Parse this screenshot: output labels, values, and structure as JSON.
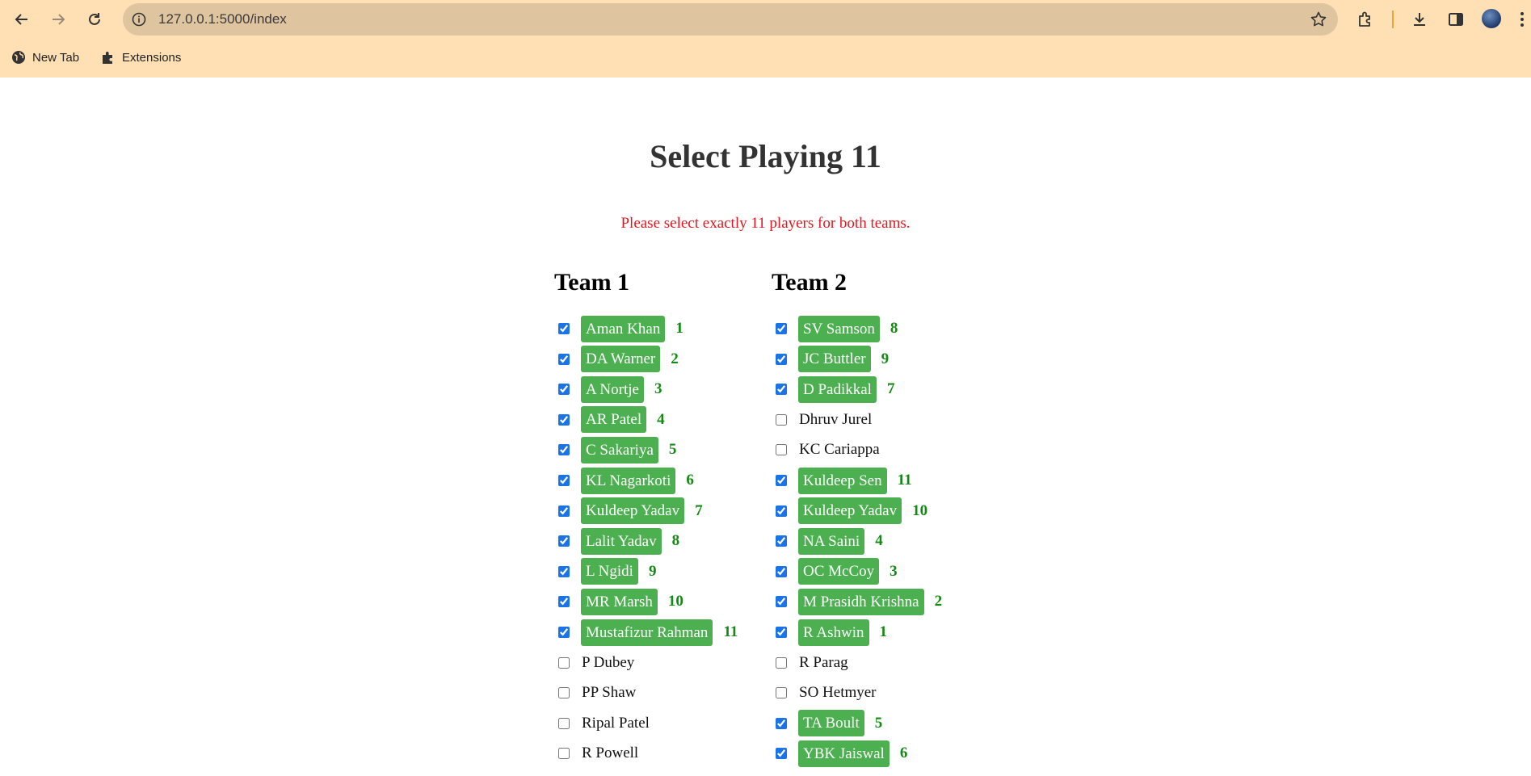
{
  "browser": {
    "url": "127.0.0.1:5000/index",
    "bookmarks": [
      {
        "label": "New Tab",
        "icon": "globe-icon"
      },
      {
        "label": "Extensions",
        "icon": "puzzle-icon"
      }
    ],
    "chrome_color": "#ffe0b5"
  },
  "page": {
    "title": "Select Playing 11",
    "error": "Please select exactly 11 players for both teams.",
    "accent_color": "#4caf50",
    "error_color": "#e8141d"
  },
  "teams": [
    {
      "name": "Team 1",
      "players": [
        {
          "name": "Aman Khan",
          "checked": true,
          "order": "1"
        },
        {
          "name": "DA Warner",
          "checked": true,
          "order": "2"
        },
        {
          "name": "A Nortje",
          "checked": true,
          "order": "3"
        },
        {
          "name": "AR Patel",
          "checked": true,
          "order": "4"
        },
        {
          "name": "C Sakariya",
          "checked": true,
          "order": "5"
        },
        {
          "name": "KL Nagarkoti",
          "checked": true,
          "order": "6"
        },
        {
          "name": "Kuldeep Yadav",
          "checked": true,
          "order": "7"
        },
        {
          "name": "Lalit Yadav",
          "checked": true,
          "order": "8"
        },
        {
          "name": "L Ngidi",
          "checked": true,
          "order": "9"
        },
        {
          "name": "MR Marsh",
          "checked": true,
          "order": "10"
        },
        {
          "name": "Mustafizur Rahman",
          "checked": true,
          "order": "11"
        },
        {
          "name": "P Dubey",
          "checked": false,
          "order": ""
        },
        {
          "name": "PP Shaw",
          "checked": false,
          "order": ""
        },
        {
          "name": "Ripal Patel",
          "checked": false,
          "order": ""
        },
        {
          "name": "R Powell",
          "checked": false,
          "order": ""
        }
      ]
    },
    {
      "name": "Team 2",
      "players": [
        {
          "name": "SV Samson",
          "checked": true,
          "order": "8"
        },
        {
          "name": "JC Buttler",
          "checked": true,
          "order": "9"
        },
        {
          "name": "D Padikkal",
          "checked": true,
          "order": "7"
        },
        {
          "name": "Dhruv Jurel",
          "checked": false,
          "order": ""
        },
        {
          "name": "KC Cariappa",
          "checked": false,
          "order": ""
        },
        {
          "name": "Kuldeep Sen",
          "checked": true,
          "order": "11"
        },
        {
          "name": "Kuldeep Yadav",
          "checked": true,
          "order": "10"
        },
        {
          "name": "NA Saini",
          "checked": true,
          "order": "4"
        },
        {
          "name": "OC McCoy",
          "checked": true,
          "order": "3"
        },
        {
          "name": "M Prasidh Krishna",
          "checked": true,
          "order": "2"
        },
        {
          "name": "R Ashwin",
          "checked": true,
          "order": "1"
        },
        {
          "name": "R Parag",
          "checked": false,
          "order": ""
        },
        {
          "name": "SO Hetmyer",
          "checked": false,
          "order": ""
        },
        {
          "name": "TA Boult",
          "checked": true,
          "order": "5"
        },
        {
          "name": "YBK Jaiswal",
          "checked": true,
          "order": "6"
        }
      ]
    }
  ]
}
